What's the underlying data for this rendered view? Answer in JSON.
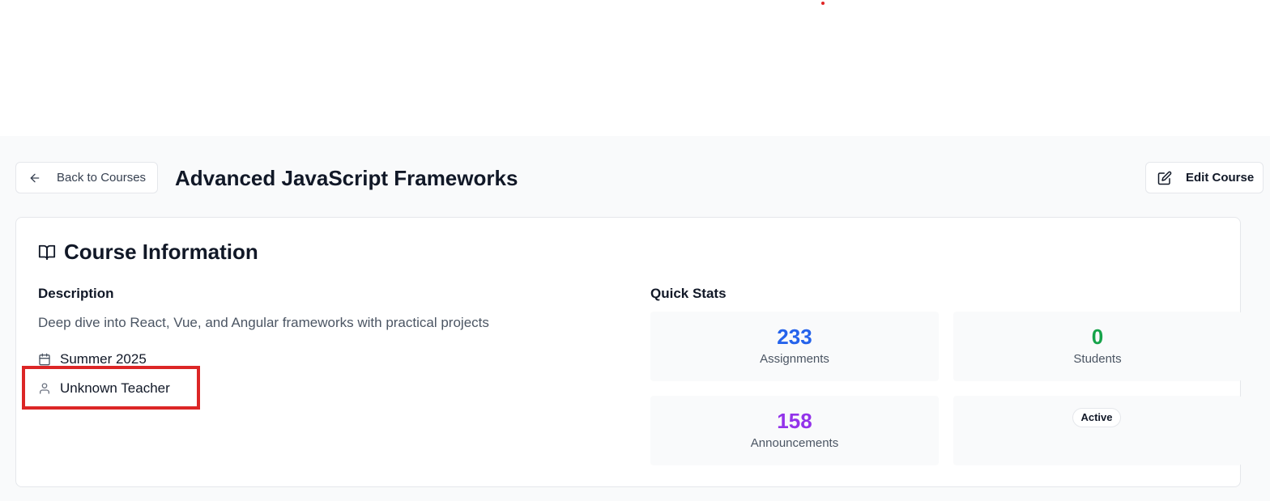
{
  "header": {
    "back_label": "Back to Courses",
    "title": "Advanced JavaScript Frameworks",
    "edit_label": "Edit Course"
  },
  "course_info": {
    "title": "Course Information",
    "description_heading": "Description",
    "description": "Deep dive into React, Vue, and Angular frameworks with practical projects",
    "term": "Summer 2025",
    "teacher": "Unknown Teacher"
  },
  "quick_stats": {
    "heading": "Quick Stats",
    "assignments": {
      "value": "233",
      "label": "Assignments",
      "color": "#2563eb"
    },
    "students": {
      "value": "0",
      "label": "Students",
      "color": "#16a34a"
    },
    "announcements": {
      "value": "158",
      "label": "Announcements",
      "color": "#9333ea"
    },
    "status": "Active"
  },
  "icons": {
    "back": "arrow-left-icon",
    "edit": "pencil-square-icon",
    "course": "book-open-icon",
    "term": "calendar-icon",
    "teacher": "user-icon"
  },
  "colors": {
    "highlight": "#dc2626",
    "page_background": "#f9fafb"
  }
}
